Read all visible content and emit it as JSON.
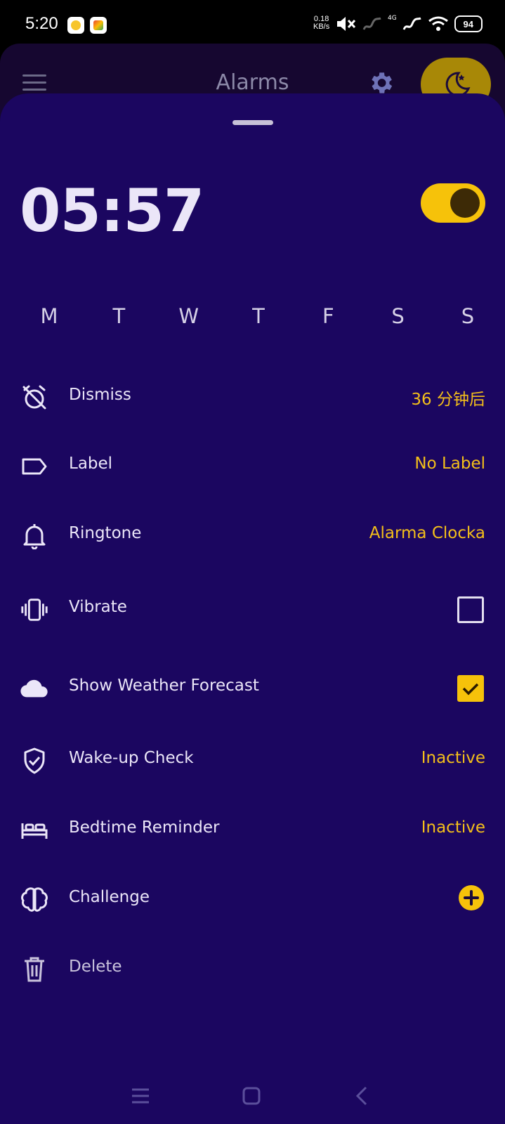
{
  "status_bar": {
    "time": "5:20",
    "net_speed_value": "0.18",
    "net_speed_unit": "KB/s",
    "network_label": "4G",
    "battery": "94"
  },
  "app_bar": {
    "title": "Alarms"
  },
  "alarm": {
    "time": "05:57",
    "enabled": true,
    "days": [
      "M",
      "T",
      "W",
      "T",
      "F",
      "S",
      "S"
    ]
  },
  "settings": {
    "dismiss": {
      "label": "Dismiss",
      "value": "36 分钟后",
      "icon": "alarm-off-icon"
    },
    "label": {
      "label": "Label",
      "value": "No Label",
      "icon": "tag-icon"
    },
    "ringtone": {
      "label": "Ringtone",
      "value": "Alarma Clocka",
      "icon": "bell-icon"
    },
    "vibrate": {
      "label": "Vibrate",
      "checked": false,
      "icon": "vibrate-icon"
    },
    "weather": {
      "label": "Show Weather Forecast",
      "checked": true,
      "icon": "cloud-icon"
    },
    "wakeup": {
      "label": "Wake-up Check",
      "value": "Inactive",
      "icon": "shield-check-icon"
    },
    "bedtime": {
      "label": "Bedtime Reminder",
      "value": "Inactive",
      "icon": "bed-icon"
    },
    "challenge": {
      "label": "Challenge",
      "icon": "brain-icon"
    },
    "delete": {
      "label": "Delete",
      "icon": "trash-icon"
    }
  },
  "colors": {
    "accent": "#f6c20a",
    "sheet_bg": "#1b0660",
    "text": "#ebe6f8"
  }
}
